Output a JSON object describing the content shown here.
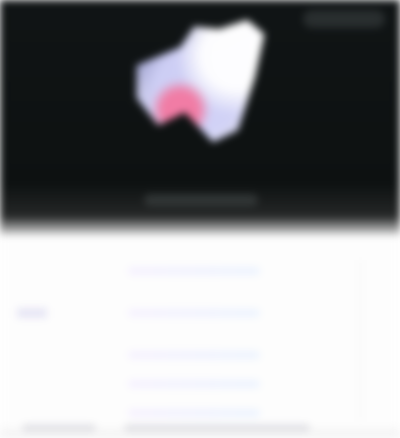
{
  "hero": {
    "title": "",
    "action_label": ""
  },
  "details": {
    "rows": [
      {
        "label": "",
        "value": ""
      },
      {
        "label": "",
        "value": ""
      },
      {
        "label": "",
        "value": ""
      },
      {
        "label": "",
        "value": ""
      },
      {
        "label": "",
        "value": ""
      }
    ]
  },
  "colors": {
    "hero_background": "#0d1111",
    "panel_background": "#fdfdfd",
    "accent": "#5a82d2"
  },
  "icons": {
    "hero_art": "blurred-artwork-icon"
  }
}
